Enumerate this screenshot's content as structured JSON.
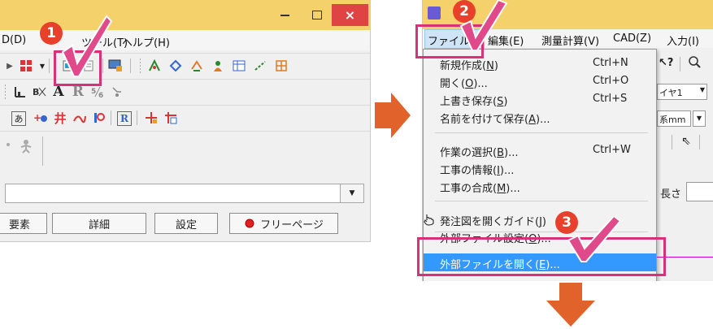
{
  "left_window": {
    "menu": {
      "data": "D(D)",
      "tool": "ツール(T)",
      "help": "ヘルプ(H)"
    },
    "close_glyph": "×",
    "toolbar_glyphs": {
      "text_a": "A",
      "text_r": "R",
      "kana": "あ",
      "hash": "井",
      "boxed_r": "R"
    },
    "buttons": {
      "element": "要素",
      "detail": "詳細",
      "settings": "設定",
      "free_page": "フリーページ"
    }
  },
  "right_window": {
    "menu": [
      {
        "label": "ファイル(F)"
      },
      {
        "label": "編集(E)"
      },
      {
        "label": "測量計算(V)"
      },
      {
        "label": "CAD(Z)"
      },
      {
        "label": "入力(I)"
      }
    ],
    "background_controls": {
      "layer_value": "イヤ1",
      "unit_value": "系mm",
      "length_label": "長さ"
    },
    "file_menu": {
      "group1": [
        {
          "label": "新規作成(",
          "key": "N",
          "end": ")",
          "shortcut": "Ctrl+N"
        },
        {
          "label": "開く(",
          "key": "O",
          "end": ")...",
          "shortcut": "Ctrl+O"
        },
        {
          "label": "上書き保存(",
          "key": "S",
          "end": ")",
          "shortcut": "Ctrl+S"
        },
        {
          "label": "名前を付けて保存(",
          "key": "A",
          "end": ")...",
          "shortcut": ""
        }
      ],
      "group2": [
        {
          "label": "作業の選択(",
          "key": "B",
          "end": ")...",
          "shortcut": "Ctrl+W"
        },
        {
          "label": "工事の情報(",
          "key": "I",
          "end": ")...",
          "shortcut": ""
        },
        {
          "label": "工事の合成(",
          "key": "M",
          "end": ")...",
          "shortcut": ""
        }
      ],
      "guide": {
        "label": "発注図を開くガイド(",
        "key": "J",
        "end": ")"
      },
      "external_settings": {
        "label": "外部ファイル設定(",
        "key": "O",
        "end": ")..."
      },
      "external_open": {
        "label": "外部ファイルを開く(",
        "key": "E",
        "end": ")..."
      }
    }
  },
  "step_badges": [
    "1",
    "2",
    "3"
  ],
  "colors": {
    "titlebar": "#f5d16c",
    "badge": "#e8402a",
    "highlight_box": "#d9307a",
    "checkmark": "#e04a8a",
    "arrow": "#e1622a",
    "selection": "#3399ff"
  }
}
